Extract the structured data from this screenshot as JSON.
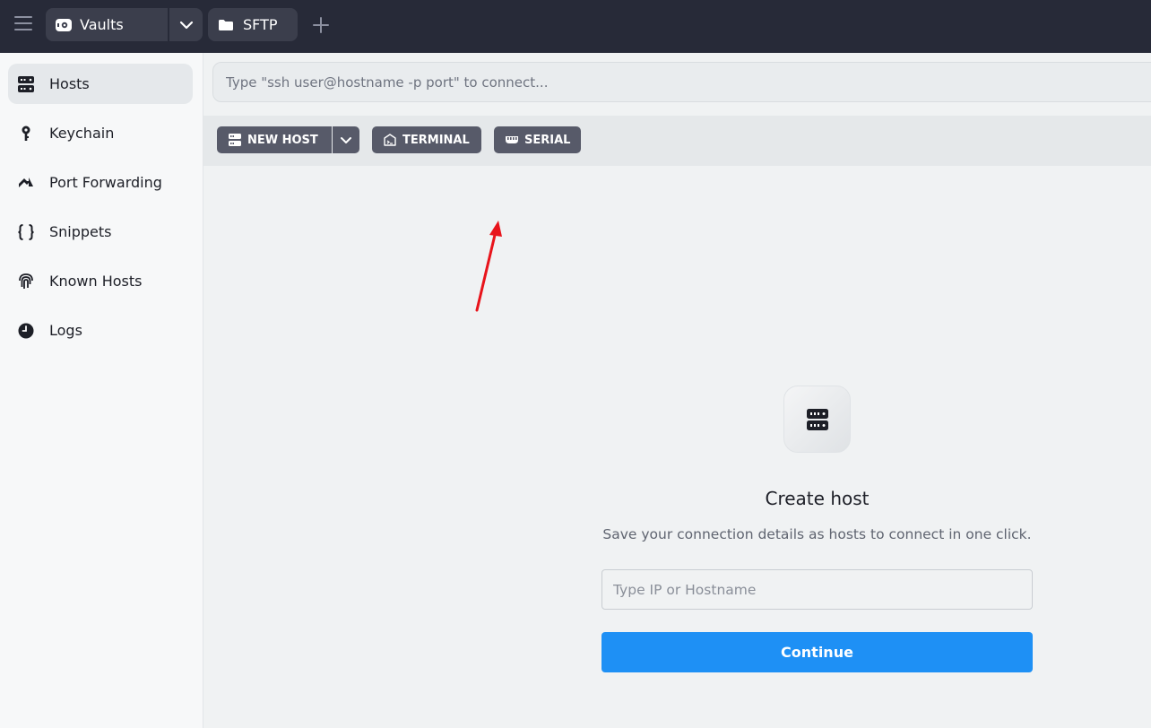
{
  "topbar": {
    "vaults_label": "Vaults",
    "tabs": [
      {
        "label": "SFTP"
      }
    ]
  },
  "sidebar": {
    "items": [
      {
        "label": "Hosts",
        "icon": "server-icon",
        "active": true
      },
      {
        "label": "Keychain",
        "icon": "key-icon"
      },
      {
        "label": "Port Forwarding",
        "icon": "port-forward-icon"
      },
      {
        "label": "Snippets",
        "icon": "braces-icon"
      },
      {
        "label": "Known Hosts",
        "icon": "fingerprint-icon"
      },
      {
        "label": "Logs",
        "icon": "clock-icon"
      }
    ]
  },
  "main": {
    "command_placeholder": "Type \"ssh user@hostname -p port\" to connect...",
    "toolbar": {
      "new_host": "NEW HOST",
      "terminal": "TERMINAL",
      "serial": "SERIAL"
    },
    "empty_state": {
      "title": "Create host",
      "subtitle": "Save your connection details as hosts to connect in one click.",
      "input_placeholder": "Type IP or Hostname",
      "button": "Continue"
    }
  },
  "colors": {
    "topbar_bg": "#272a38",
    "accent": "#1e90f5",
    "toolbar_button": "#575a69",
    "annotation_arrow": "#e8141b"
  }
}
